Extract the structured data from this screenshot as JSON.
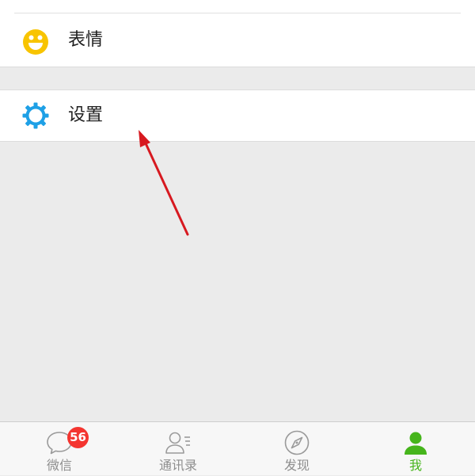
{
  "menu": {
    "emoji_label": "表情",
    "settings_label": "设置"
  },
  "tabbar": {
    "chats_label": "微信",
    "chats_badge": "56",
    "contacts_label": "通讯录",
    "discover_label": "发现",
    "me_label": "我",
    "active_tab": "我"
  },
  "colors": {
    "accent_green": "#46b51c",
    "badge_red": "#f43530",
    "emoji_yellow": "#f8c400",
    "settings_blue": "#1ea0e6",
    "arrow_red": "#d71920"
  },
  "icons": {
    "emoji": "smile-icon",
    "settings": "gear-icon",
    "chats": "chat-bubble-icon",
    "contacts": "contacts-icon",
    "discover": "compass-icon",
    "me": "person-icon"
  }
}
